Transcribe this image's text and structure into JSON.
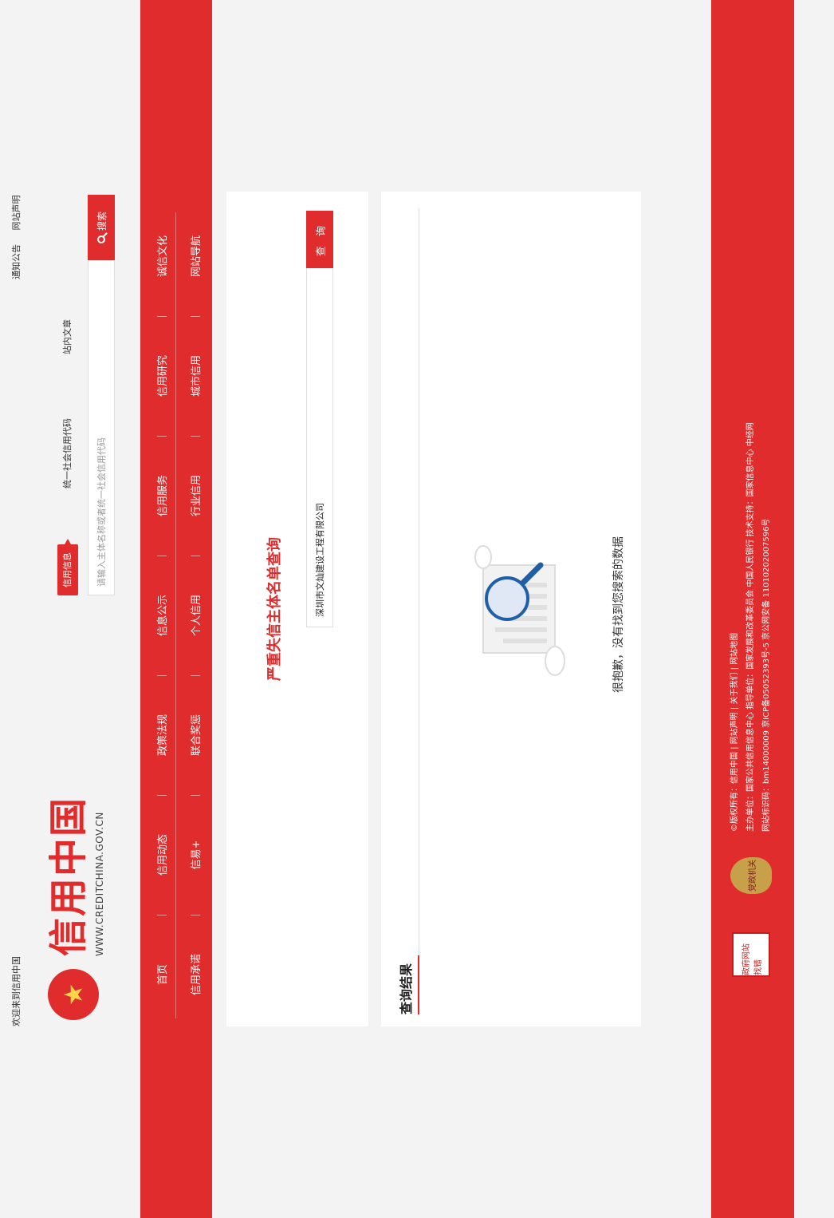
{
  "topbar": {
    "welcome": "欢迎来到信用中国",
    "links": [
      "通知公告",
      "网站声明"
    ]
  },
  "logo": {
    "title": "信用中国",
    "subtitle": "WWW.CREDITCHINA.GOV.CN"
  },
  "search": {
    "tabs": [
      "信用信息",
      "统一社会信用代码",
      "站内文章"
    ],
    "placeholder": "请输入主体名称或者统一社会信用代码",
    "button": "搜索"
  },
  "nav": {
    "row1": [
      "首页",
      "信用动态",
      "政策法规",
      "信息公示",
      "信用服务",
      "信用研究",
      "诚信文化"
    ],
    "row2": [
      "信用承诺",
      "信易+",
      "联合奖惩",
      "个人信用",
      "行业信用",
      "城市信用",
      "网站导航"
    ]
  },
  "query": {
    "title": "严重失信主体名单查询",
    "value": "深圳市文灿建设工程有限公司",
    "button": "查 询"
  },
  "result": {
    "title": "查询结果",
    "empty_text": "很抱歉，没有找到您搜索的数据"
  },
  "footer": {
    "badge1": "政府网站 找错",
    "badge2": "党政机关",
    "lines": [
      "©版权所有：信用中国 | 网站声明 | 关于我们 | 网站地图",
      "主办单位：国家公共信用信息中心  指导单位：国家发展和改革委员会 中国人民银行  技术支持：国家信息中心 中经网",
      "网站标识码：bm14000009 京ICP备05052393号-5 京公网安备 11010202007596号"
    ]
  }
}
